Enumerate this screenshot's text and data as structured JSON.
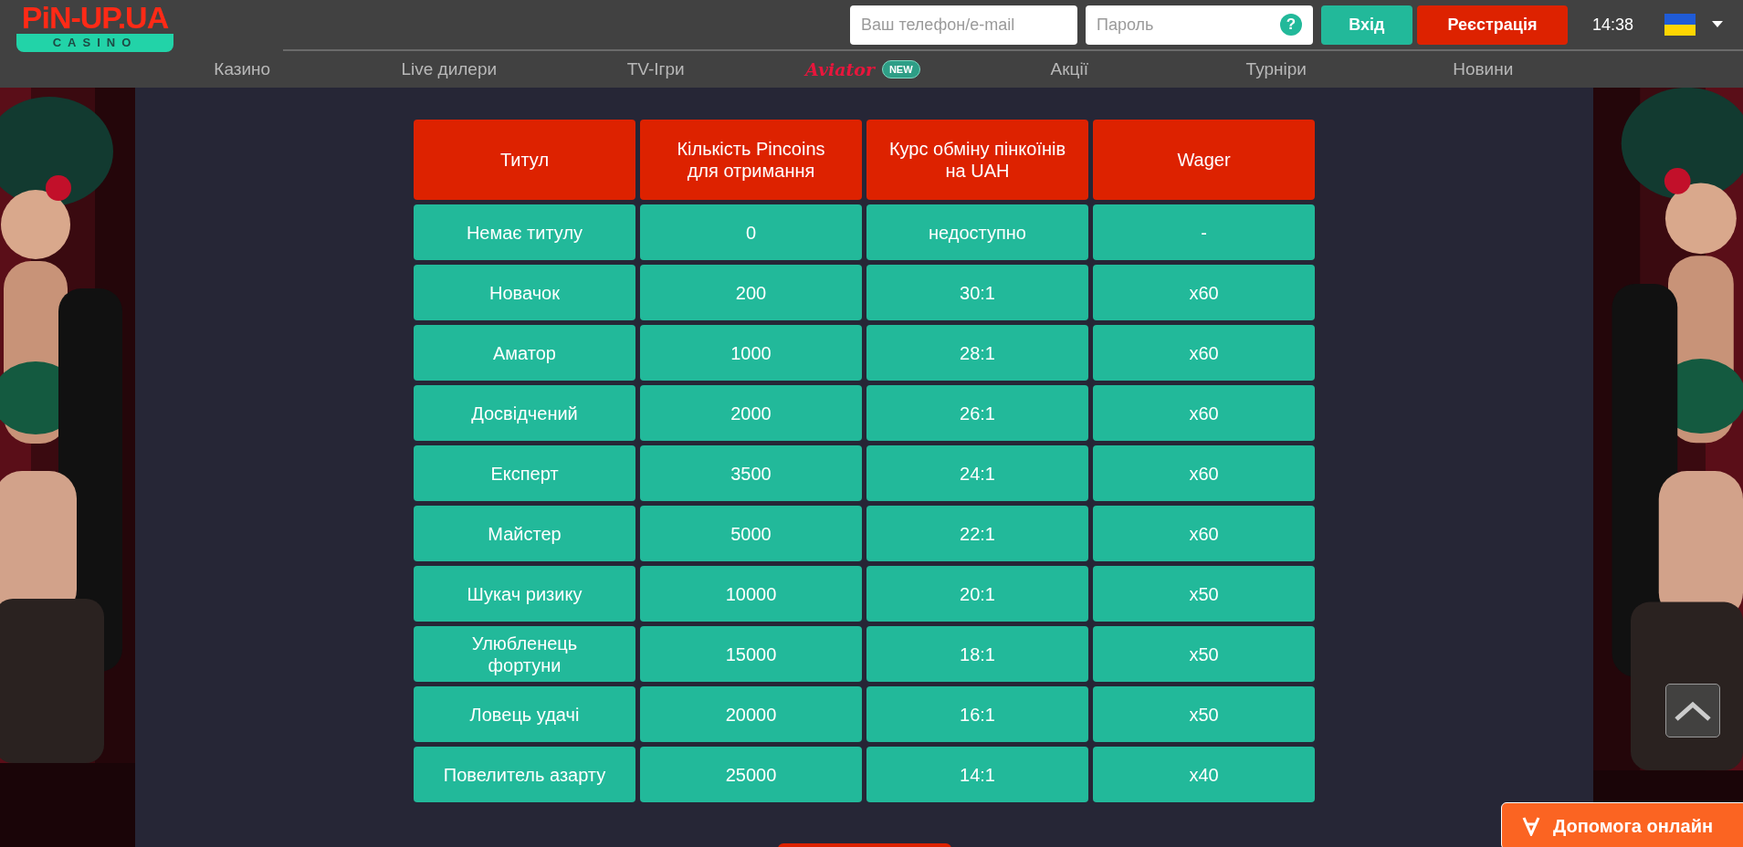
{
  "logo": {
    "brand": "PiN-UP.UA",
    "tagline": "CASINO"
  },
  "login": {
    "phone_placeholder": "Ваш телефон/e-mail",
    "password_placeholder": "Пароль",
    "help": "?",
    "login_button": "Вхід",
    "register_button": "Реєстрація"
  },
  "time": "14:38",
  "nav": [
    {
      "kind": "link",
      "label": "Казино"
    },
    {
      "kind": "link",
      "label": "Live дилери"
    },
    {
      "kind": "link",
      "label": "TV-Ігри"
    },
    {
      "kind": "brand",
      "label": "Aviator",
      "badge": "NEW"
    },
    {
      "kind": "link",
      "label": "Акції"
    },
    {
      "kind": "link",
      "label": "Турніри"
    },
    {
      "kind": "link",
      "label": "Новини"
    }
  ],
  "table": {
    "columns": [
      "Титул",
      "Кількість Pincoins для отримання",
      "Курс обміну пінкоїнів на UAH",
      "Wager"
    ],
    "rows": [
      [
        "Немає титулу",
        "0",
        "недоступно",
        "-"
      ],
      [
        "Новачок",
        "200",
        "30:1",
        "x60"
      ],
      [
        "Аматор",
        "1000",
        "28:1",
        "x60"
      ],
      [
        "Досвідчений",
        "2000",
        "26:1",
        "x60"
      ],
      [
        "Експерт",
        "3500",
        "24:1",
        "x60"
      ],
      [
        "Майстер",
        "5000",
        "22:1",
        "x60"
      ],
      [
        "Шукач ризику",
        "10000",
        "20:1",
        "x50"
      ],
      [
        "Улюбленець фортуни",
        "15000",
        "18:1",
        "x50"
      ],
      [
        "Ловець удачі",
        "20000",
        "16:1",
        "x50"
      ],
      [
        "Повелитель азарту",
        "25000",
        "14:1",
        "x40"
      ]
    ]
  },
  "help_chat": {
    "label": "Допомога онлайн"
  }
}
